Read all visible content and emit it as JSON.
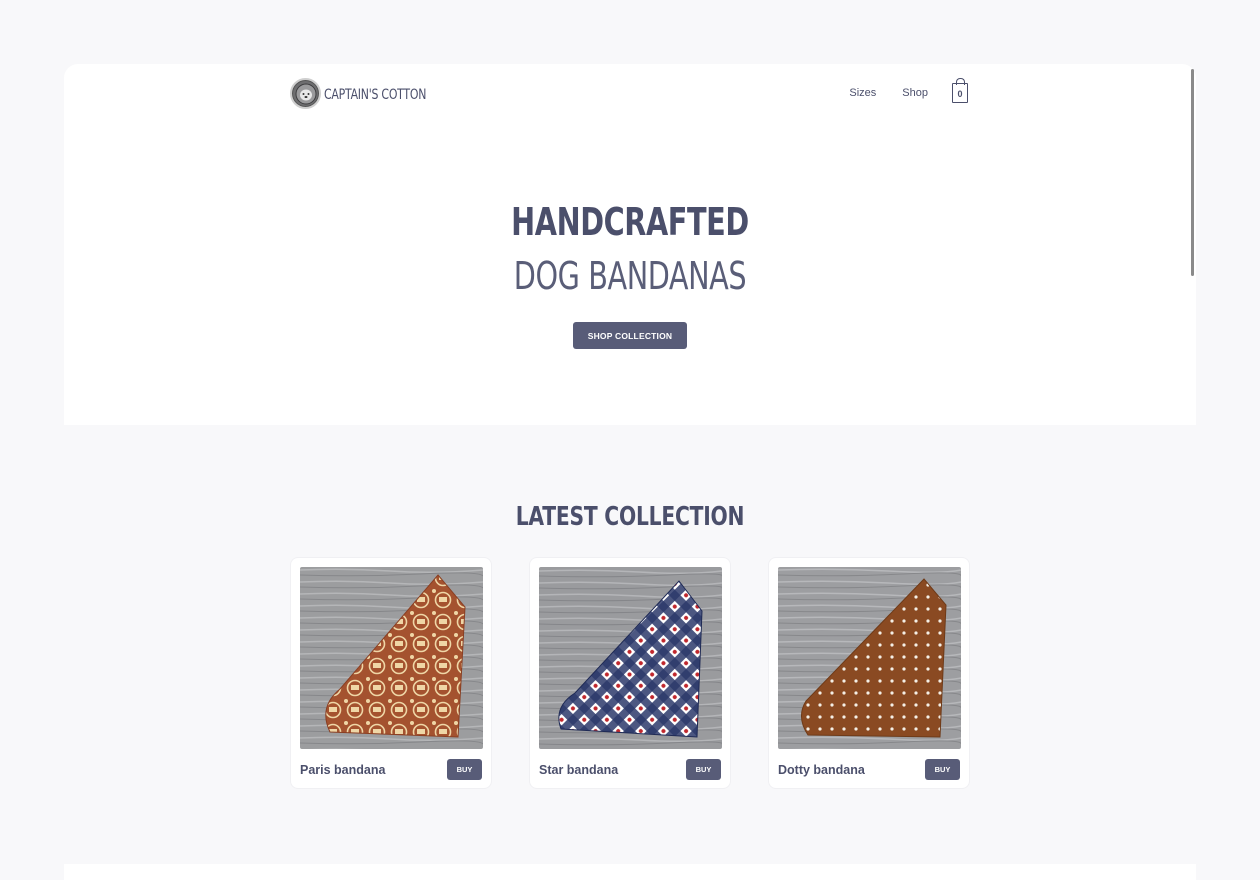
{
  "brand": {
    "name": "CAPTAIN'S COTTON"
  },
  "nav": {
    "links": [
      "Sizes",
      "Shop"
    ],
    "cart_count": "0"
  },
  "hero": {
    "title_line1": "HANDCRAFTED",
    "title_line2": "DOG BANDANAS",
    "cta_label": "SHOP COLLECTION"
  },
  "collection": {
    "title": "LATEST COLLECTION",
    "products": [
      {
        "name": "Paris bandana",
        "buy_label": "BUY",
        "pattern": "paris-stamps"
      },
      {
        "name": "Star bandana",
        "buy_label": "BUY",
        "pattern": "navy-plaid-stars"
      },
      {
        "name": "Dotty bandana",
        "buy_label": "BUY",
        "pattern": "brown-polka-dots"
      }
    ]
  },
  "colors": {
    "accent": "#585c78",
    "text": "#4b4f6b",
    "page_bg": "#f8f8fa",
    "card_bg": "#ffffff"
  }
}
